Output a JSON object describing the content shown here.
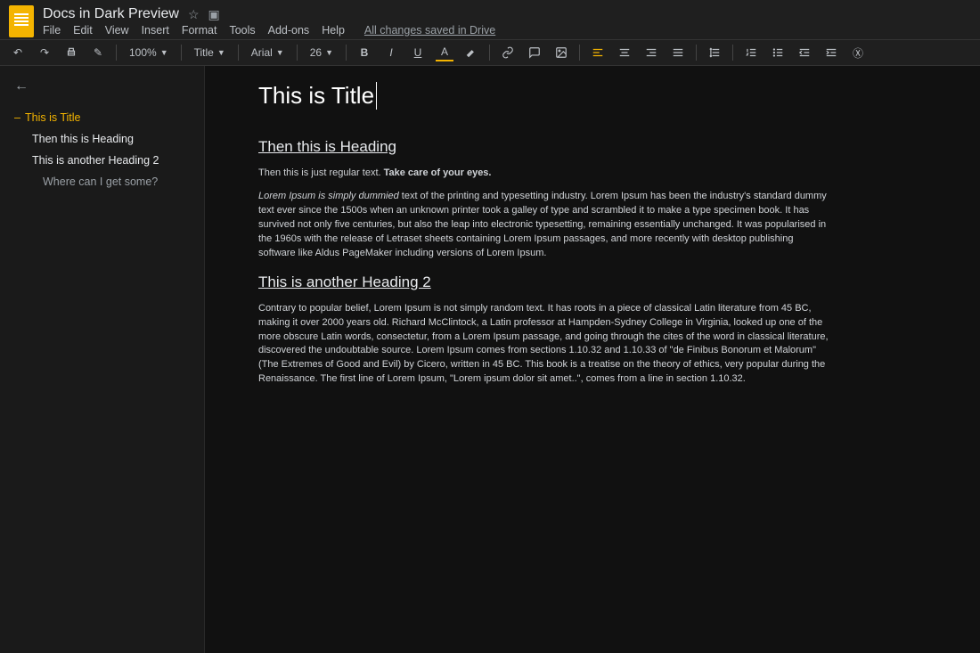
{
  "header": {
    "doc_title": "Docs in Dark Preview",
    "save_status": "All changes saved in Drive"
  },
  "menu": {
    "file": "File",
    "edit": "Edit",
    "view": "View",
    "insert": "Insert",
    "format": "Format",
    "tools": "Tools",
    "addons": "Add-ons",
    "help": "Help"
  },
  "toolbar": {
    "zoom": "100%",
    "style": "Title",
    "font": "Arial",
    "size": "26"
  },
  "outline": {
    "items": [
      {
        "label": "This is Title",
        "level": 1,
        "active": true
      },
      {
        "label": "Then this is Heading",
        "level": 2,
        "active": false
      },
      {
        "label": "This is another Heading 2",
        "level": 2,
        "active": false
      },
      {
        "label": "Where can I get some?",
        "level": 3,
        "active": false
      }
    ]
  },
  "document": {
    "title": "This is Title",
    "heading1": "Then this is Heading",
    "intro_plain": "Then this is just regular text. ",
    "intro_bold": "Take care of your eyes.",
    "para1_lead_italic": "Lorem Ipsum is simply dummied",
    "para1_rest": " text of the printing and typesetting industry. Lorem Ipsum has been the industry's standard dummy text ever since the 1500s when an unknown printer took a galley of type and scrambled it to make a type specimen book. It has survived not only five centuries, but also the leap into electronic typesetting, remaining essentially unchanged. It was popularised in the 1960s with the release of Letraset sheets containing Lorem Ipsum passages, and more recently with desktop publishing software like Aldus PageMaker including versions of Lorem Ipsum.",
    "heading2": "This is another Heading 2",
    "para2": "Contrary to popular belief, Lorem Ipsum is not simply random text. It has roots in a piece of classical Latin literature from 45 BC, making it over 2000 years old. Richard McClintock, a Latin professor at Hampden-Sydney College in Virginia, looked up one of the more obscure Latin words, consectetur, from a Lorem Ipsum passage, and going through the cites of the word in classical literature, discovered the undoubtable source. Lorem Ipsum comes from sections 1.10.32 and 1.10.33 of \"de Finibus Bonorum et Malorum\" (The Extremes of Good and Evil) by Cicero, written in 45 BC. This book is a treatise on the theory of ethics, very popular during the Renaissance. The first line of Lorem Ipsum, \"Lorem ipsum dolor sit amet..\", comes from a line in section 1.10.32."
  }
}
